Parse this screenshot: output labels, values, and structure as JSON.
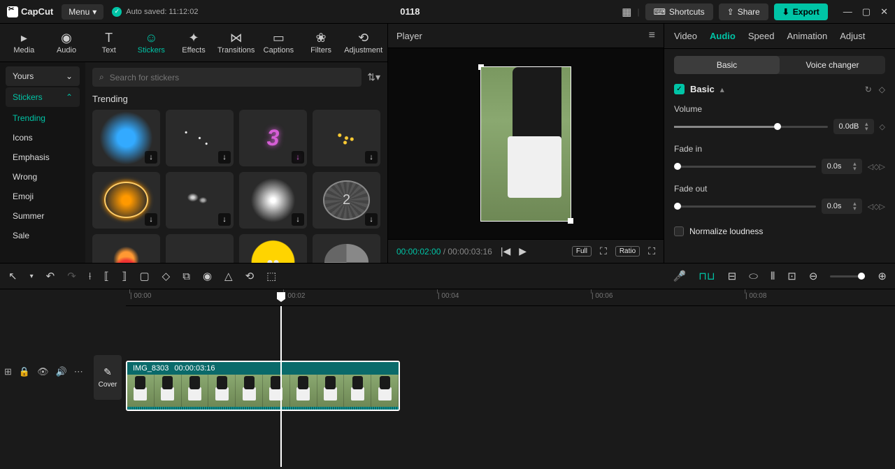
{
  "app": {
    "name": "CapCut",
    "menu_label": "Menu",
    "autosave": "Auto saved: 11:12:02",
    "project_title": "0118"
  },
  "top_buttons": {
    "shortcuts": "Shortcuts",
    "share": "Share",
    "export": "Export"
  },
  "top_tabs": [
    {
      "label": "Media",
      "icon": "▸"
    },
    {
      "label": "Audio",
      "icon": "◉"
    },
    {
      "label": "Text",
      "icon": "T"
    },
    {
      "label": "Stickers",
      "icon": "☺",
      "active": true
    },
    {
      "label": "Effects",
      "icon": "✦"
    },
    {
      "label": "Transitions",
      "icon": "⋈"
    },
    {
      "label": "Captions",
      "icon": "▭"
    },
    {
      "label": "Filters",
      "icon": "❀"
    },
    {
      "label": "Adjustment",
      "icon": "⟲"
    }
  ],
  "sidebar": {
    "yours": "Yours",
    "stickers": "Stickers",
    "items": [
      "Trending",
      "Icons",
      "Emphasis",
      "Wrong",
      "Emoji",
      "Summer",
      "Sale"
    ],
    "selected": "Trending"
  },
  "search": {
    "placeholder": "Search for stickers"
  },
  "section_title": "Trending",
  "preview": {
    "label": "Player",
    "current": "00:00:02:00",
    "duration": "00:00:03:16",
    "full": "Full",
    "ratio": "Ratio"
  },
  "right": {
    "tabs": [
      "Video",
      "Audio",
      "Speed",
      "Animation",
      "Adjust"
    ],
    "active_tab": "Audio",
    "subtabs": {
      "basic": "Basic",
      "voice": "Voice changer"
    },
    "basic_label": "Basic",
    "volume": {
      "label": "Volume",
      "value": "0.0dB"
    },
    "fade_in": {
      "label": "Fade in",
      "value": "0.0s"
    },
    "fade_out": {
      "label": "Fade out",
      "value": "0.0s"
    },
    "normalize": "Normalize loudness"
  },
  "ruler": [
    "00:00",
    "00:02",
    "00:04",
    "00:06",
    "00:08"
  ],
  "clip": {
    "name": "IMG_8303",
    "duration": "00:00:03:16"
  },
  "cover": "Cover"
}
